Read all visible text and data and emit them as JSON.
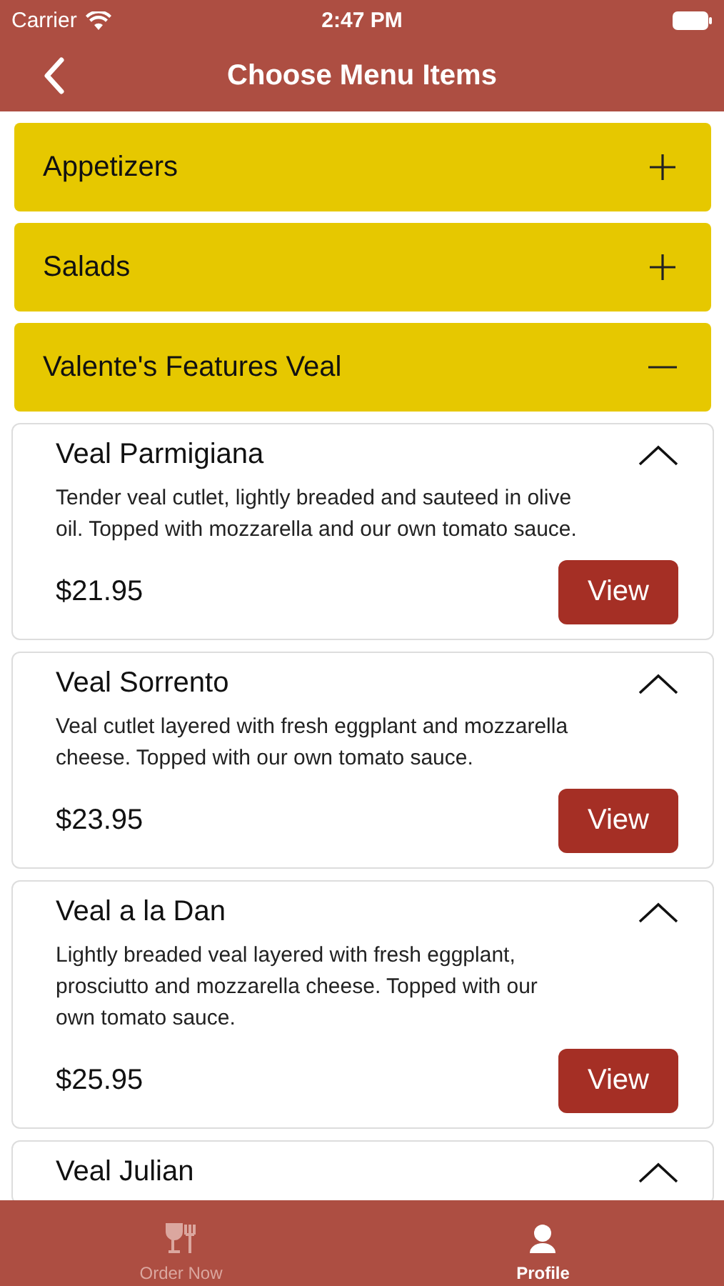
{
  "status_bar": {
    "carrier": "Carrier",
    "time": "2:47 PM"
  },
  "nav_bar": {
    "title": "Choose Menu Items"
  },
  "categories": [
    {
      "name": "Appetizers",
      "expanded": false
    },
    {
      "name": "Salads",
      "expanded": false
    },
    {
      "name": "Valente's Features Veal",
      "expanded": true
    }
  ],
  "items": [
    {
      "name": "Veal Parmigiana",
      "description": "Tender veal cutlet, lightly breaded and sauteed in olive oil. Topped with mozzarella and our own tomato sauce.",
      "price": "$21.95",
      "button": "View",
      "expanded": true
    },
    {
      "name": "Veal Sorrento",
      "description": "Veal cutlet layered with fresh eggplant and mozzarella cheese. Topped with our own tomato sauce.",
      "price": "$23.95",
      "button": "View",
      "expanded": true
    },
    {
      "name": "Veal a la Dan",
      "description": "Lightly breaded veal layered with fresh eggplant, prosciutto and mozzarella cheese. Topped with our own tomato sauce.",
      "price": "$25.95",
      "button": "View",
      "expanded": true
    },
    {
      "name": "Veal Julian",
      "expanded": true
    }
  ],
  "tab_bar": [
    {
      "label": "Order Now",
      "kind": "dining",
      "selected": false
    },
    {
      "label": "Profile",
      "kind": "profile",
      "selected": true
    }
  ]
}
